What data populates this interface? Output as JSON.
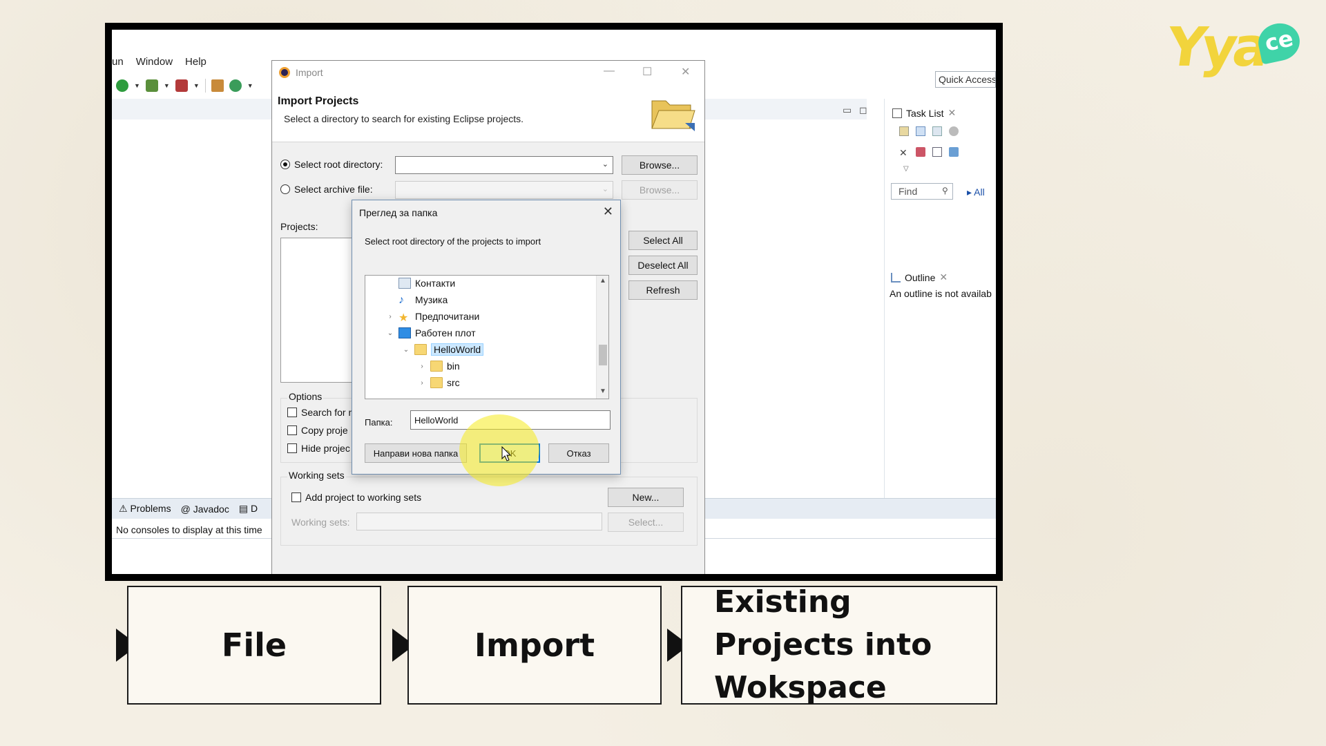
{
  "ide": {
    "menu": [
      "un",
      "Window",
      "Help"
    ],
    "quick_access": "Quick Access",
    "task_list_tab": "Task List",
    "find_placeholder": "Find",
    "all_link": "All",
    "outline_tab": "Outline",
    "outline_message": "An outline is not availab",
    "bottom_tabs": [
      "Problems",
      "Javadoc",
      "D"
    ],
    "console_message": "No consoles to display at this time"
  },
  "import_dialog": {
    "title": "Import",
    "heading": "Import Projects",
    "subtitle": "Select a directory to search for existing Eclipse projects.",
    "root_dir_label": "Select root directory:",
    "archive_label": "Select archive file:",
    "browse_label": "Browse...",
    "browse_label_disabled": "Browse...",
    "projects_label": "Projects:",
    "select_all": "Select All",
    "deselect_all": "Deselect All",
    "refresh": "Refresh",
    "options_label": "Options",
    "options": [
      "Search for n",
      "Copy proje",
      "Hide projec"
    ],
    "working_sets_label": "Working sets",
    "add_to_working_sets": "Add project to working sets",
    "new_button": "New...",
    "working_sets_field_label": "Working sets:",
    "select_button": "Select..."
  },
  "browse_dialog": {
    "title": "Преглед за папка",
    "description": "Select root directory of the projects to import",
    "tree": [
      {
        "label": "Контакти",
        "icon": "contacts-icon",
        "expander": ""
      },
      {
        "label": "Музика",
        "icon": "music-icon",
        "expander": ""
      },
      {
        "label": "Предпочитани",
        "icon": "star-icon",
        "expander": "›"
      },
      {
        "label": "Работен плот",
        "icon": "desktop-icon",
        "expander": "⌄"
      },
      {
        "label": "HelloWorld",
        "icon": "folder-icon",
        "expander": "⌄",
        "selected": true
      },
      {
        "label": "bin",
        "icon": "folder-icon",
        "expander": "›"
      },
      {
        "label": "src",
        "icon": "folder-icon",
        "expander": "›"
      }
    ],
    "folder_label": "Папка:",
    "folder_value": "HelloWorld",
    "new_folder_button": "Направи нова папка",
    "ok_button": "OK",
    "cancel_button": "Отказ"
  },
  "steps": [
    "File",
    "Import",
    "Existing Projects into Wokspace"
  ],
  "colors": {
    "highlight": "#f5eb1e",
    "logo_yellow": "#f2d43c",
    "logo_green": "#3fd3a8",
    "selection": "#cce8ff"
  }
}
